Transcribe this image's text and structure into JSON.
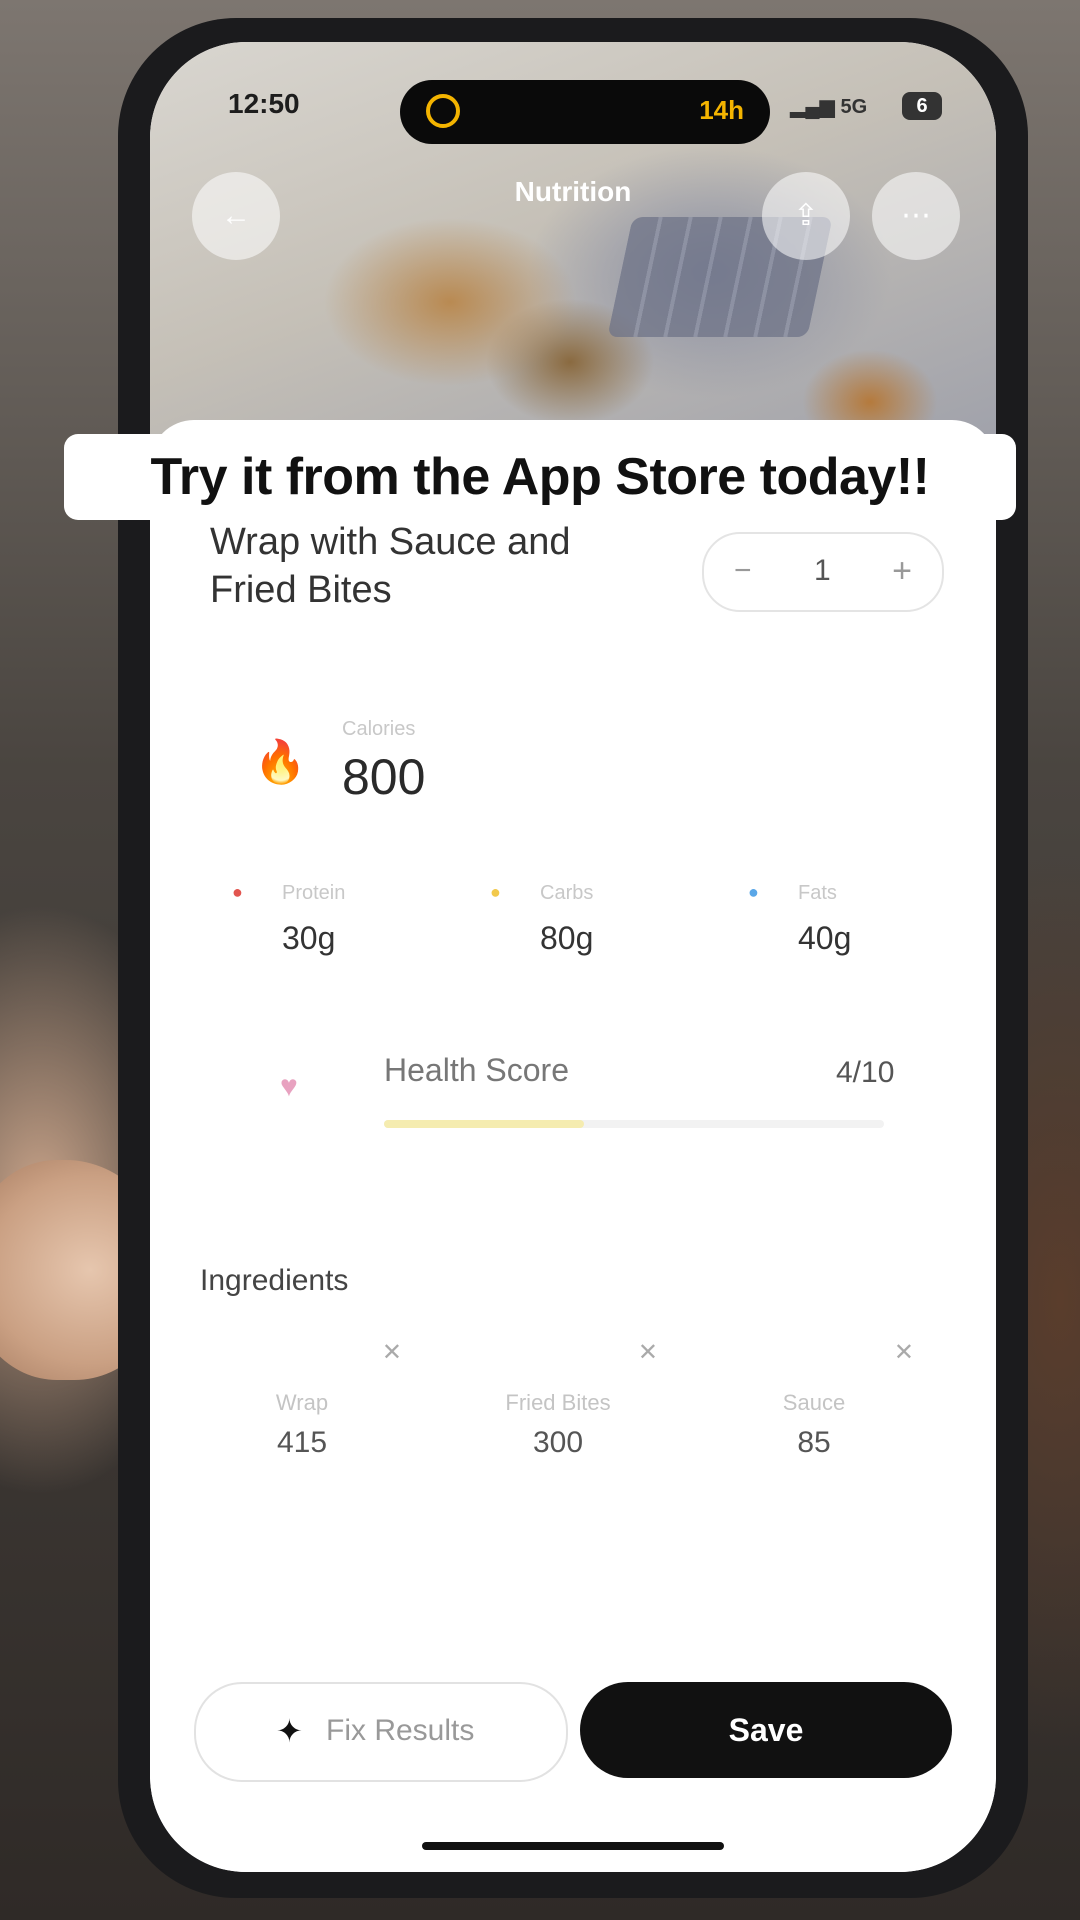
{
  "status_bar": {
    "time": "12:50",
    "timer": "14h",
    "network": "5G",
    "battery": "6"
  },
  "header": {
    "title": "Nutrition",
    "back_icon": "arrow-left-icon",
    "share_icon": "share-icon",
    "more_icon": "more-icon"
  },
  "caption": "Try it from the App Store today!!",
  "food": {
    "name": "Wrap with Sauce and Fried Bites",
    "quantity": "1",
    "minus": "−",
    "plus": "+"
  },
  "calories": {
    "label": "Calories",
    "value": "800"
  },
  "macros": [
    {
      "label": "Protein",
      "value": "30g",
      "color": "#e2554f"
    },
    {
      "label": "Carbs",
      "value": "80g",
      "color": "#f2c94c"
    },
    {
      "label": "Fats",
      "value": "40g",
      "color": "#5aa7e8"
    }
  ],
  "health_score": {
    "label": "Health Score",
    "value": "4/10",
    "fraction": 0.4
  },
  "ingredients": {
    "title": "Ingredients",
    "items": [
      {
        "name": "Wrap",
        "value": "415"
      },
      {
        "name": "Fried Bites",
        "value": "300"
      },
      {
        "name": "Sauce",
        "value": "85"
      }
    ]
  },
  "buttons": {
    "fix": "Fix Results",
    "save": "Save"
  }
}
